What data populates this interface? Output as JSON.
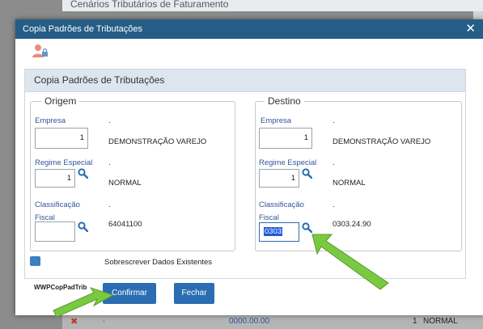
{
  "background": {
    "top_title": "Cenários Tributários de Faturamento",
    "bottom_row": {
      "dot": ".",
      "code": "0000.00.00",
      "number": "1",
      "regime": "NORMAL"
    }
  },
  "dialog": {
    "title": "Copia Padrões de Tributações",
    "close_glyph": "✕",
    "panel_title": "Copia Padrões de Tributações",
    "origem": {
      "legend": "Origem",
      "empresa_label": "Empresa",
      "empresa_value": "1",
      "empresa_dot": ".",
      "empresa_name": "DEMONSTRAÇÃO VAREJO",
      "regime_label": "Regime Especial",
      "regime_value": "1",
      "regime_dot": ".",
      "regime_name": "NORMAL",
      "classificacao_label_1": "Classificação",
      "classificacao_label_2": "Fiscal",
      "classificacao_value": "",
      "classificacao_dot": ".",
      "classificacao_name": "64041100"
    },
    "destino": {
      "legend": "Destino",
      "empresa_label": "Empresa",
      "empresa_value": "1",
      "empresa_dot": ".",
      "empresa_name": "DEMONSTRAÇÃO VAREJO",
      "regime_label": "Regime Especial",
      "regime_value": "1",
      "regime_dot": ".",
      "regime_name": "NORMAL",
      "classificacao_label_1": "Classificação",
      "classificacao_label_2": "Fiscal",
      "classificacao_value": "0303",
      "classificacao_dot": ".",
      "classificacao_name": "0303.24.90"
    },
    "checkbox_label": "Sobrescrever Dados Existentes",
    "program_name": "WWPCopPadTrib",
    "confirm_label": "Confirmar",
    "close_label": "Fechar"
  },
  "colors": {
    "titlebar": "#255d87",
    "button": "#2a6db2",
    "label": "#31559a",
    "annotation_arrow": "#7ac943"
  },
  "icons": [
    "user-lock-icon",
    "search-icon",
    "close-icon",
    "arrow-annotation"
  ]
}
